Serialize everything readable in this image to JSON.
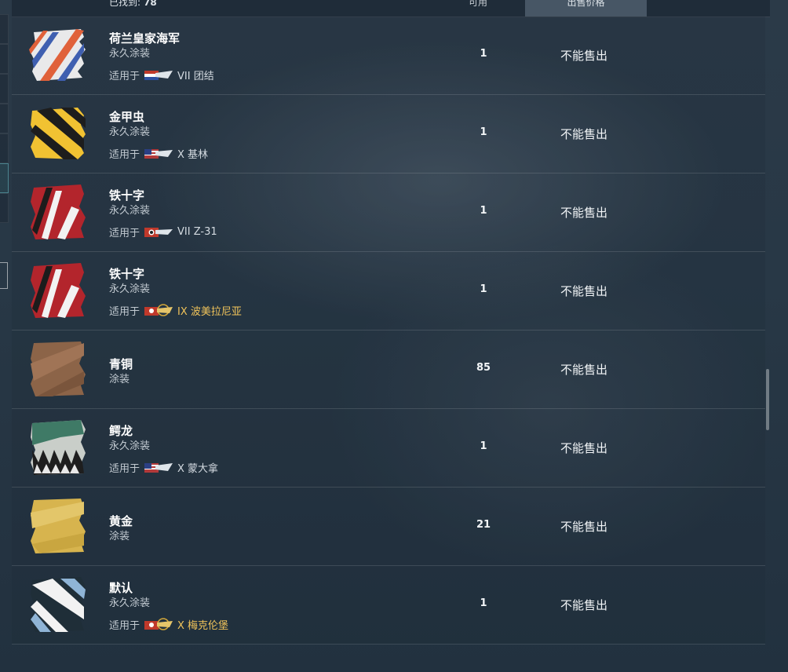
{
  "header": {
    "found_label": "已找到:",
    "found_count": "78",
    "col_available": "可用",
    "col_price": "出售价格"
  },
  "items": [
    {
      "name": "荷兰皇家海军",
      "type": "永久涂装",
      "applies_label": "适用于",
      "ship": "VII 团结",
      "count": "1",
      "sale": "不能售出",
      "thumb": "dutch-camo-icon"
    },
    {
      "name": "金甲虫",
      "type": "永久涂装",
      "applies_label": "适用于",
      "ship": "X 基林",
      "count": "1",
      "sale": "不能售出",
      "thumb": "gold-beetle-camo-icon"
    },
    {
      "name": "铁十字",
      "type": "永久涂装",
      "applies_label": "适用于",
      "ship": "VII Z-31",
      "count": "1",
      "sale": "不能售出",
      "thumb": "iron-cross-camo-icon"
    },
    {
      "name": "铁十字",
      "type": "永久涂装",
      "applies_label": "适用于",
      "ship": "IX 波美拉尼亚",
      "count": "1",
      "sale": "不能售出",
      "thumb": "iron-cross-camo-icon"
    },
    {
      "name": "青铜",
      "type": "涂装",
      "count": "85",
      "sale": "不能售出",
      "thumb": "bronze-camo-icon"
    },
    {
      "name": "鳄龙",
      "type": "永久涂装",
      "applies_label": "适用于",
      "ship": "X 蒙大拿",
      "count": "1",
      "sale": "不能售出",
      "thumb": "crocodile-camo-icon"
    },
    {
      "name": "黄金",
      "type": "涂装",
      "count": "21",
      "sale": "不能售出",
      "thumb": "gold-camo-icon"
    },
    {
      "name": "默认",
      "type": "永久涂装",
      "applies_label": "适用于",
      "ship": "X 梅克伦堡",
      "count": "1",
      "sale": "不能售出",
      "thumb": "default-camo-icon"
    }
  ],
  "colors": {
    "premium_ship": "#f0c35a",
    "background": "#283846"
  }
}
